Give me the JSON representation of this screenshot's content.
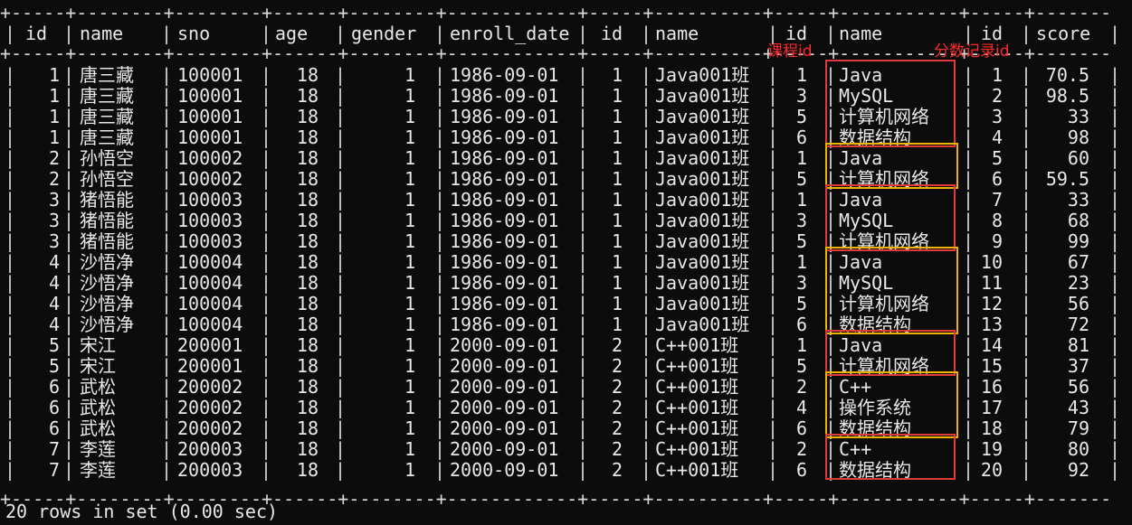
{
  "columns": [
    "id",
    "name",
    "sno",
    "age",
    "gender",
    "enroll_date",
    "id",
    "name",
    "id",
    "name",
    "id",
    "score"
  ],
  "annotations": {
    "course_id": "课程id",
    "score_record_id": "分数记录id"
  },
  "rows": [
    [
      "1",
      "唐三藏",
      "100001",
      "18",
      "1",
      "1986-09-01",
      "1",
      "Java001班",
      "1",
      "Java",
      "1",
      "70.5"
    ],
    [
      "1",
      "唐三藏",
      "100001",
      "18",
      "1",
      "1986-09-01",
      "1",
      "Java001班",
      "3",
      "MySQL",
      "2",
      "98.5"
    ],
    [
      "1",
      "唐三藏",
      "100001",
      "18",
      "1",
      "1986-09-01",
      "1",
      "Java001班",
      "5",
      "计算机网络",
      "3",
      "33"
    ],
    [
      "1",
      "唐三藏",
      "100001",
      "18",
      "1",
      "1986-09-01",
      "1",
      "Java001班",
      "6",
      "数据结构",
      "4",
      "98"
    ],
    [
      "2",
      "孙悟空",
      "100002",
      "18",
      "1",
      "1986-09-01",
      "1",
      "Java001班",
      "1",
      "Java",
      "5",
      "60"
    ],
    [
      "2",
      "孙悟空",
      "100002",
      "18",
      "1",
      "1986-09-01",
      "1",
      "Java001班",
      "5",
      "计算机网络",
      "6",
      "59.5"
    ],
    [
      "3",
      "猪悟能",
      "100003",
      "18",
      "1",
      "1986-09-01",
      "1",
      "Java001班",
      "1",
      "Java",
      "7",
      "33"
    ],
    [
      "3",
      "猪悟能",
      "100003",
      "18",
      "1",
      "1986-09-01",
      "1",
      "Java001班",
      "3",
      "MySQL",
      "8",
      "68"
    ],
    [
      "3",
      "猪悟能",
      "100003",
      "18",
      "1",
      "1986-09-01",
      "1",
      "Java001班",
      "5",
      "计算机网络",
      "9",
      "99"
    ],
    [
      "4",
      "沙悟净",
      "100004",
      "18",
      "1",
      "1986-09-01",
      "1",
      "Java001班",
      "1",
      "Java",
      "10",
      "67"
    ],
    [
      "4",
      "沙悟净",
      "100004",
      "18",
      "1",
      "1986-09-01",
      "1",
      "Java001班",
      "3",
      "MySQL",
      "11",
      "23"
    ],
    [
      "4",
      "沙悟净",
      "100004",
      "18",
      "1",
      "1986-09-01",
      "1",
      "Java001班",
      "5",
      "计算机网络",
      "12",
      "56"
    ],
    [
      "4",
      "沙悟净",
      "100004",
      "18",
      "1",
      "1986-09-01",
      "1",
      "Java001班",
      "6",
      "数据结构",
      "13",
      "72"
    ],
    [
      "5",
      "宋江",
      "200001",
      "18",
      "1",
      "2000-09-01",
      "2",
      "C++001班",
      "1",
      "Java",
      "14",
      "81"
    ],
    [
      "5",
      "宋江",
      "200001",
      "18",
      "1",
      "2000-09-01",
      "2",
      "C++001班",
      "5",
      "计算机网络",
      "15",
      "37"
    ],
    [
      "6",
      "武松",
      "200002",
      "18",
      "1",
      "2000-09-01",
      "2",
      "C++001班",
      "2",
      "C++",
      "16",
      "56"
    ],
    [
      "6",
      "武松",
      "200002",
      "18",
      "1",
      "2000-09-01",
      "2",
      "C++001班",
      "4",
      "操作系统",
      "17",
      "43"
    ],
    [
      "6",
      "武松",
      "200002",
      "18",
      "1",
      "2000-09-01",
      "2",
      "C++001班",
      "6",
      "数据结构",
      "18",
      "79"
    ],
    [
      "7",
      "李莲",
      "200003",
      "18",
      "1",
      "2000-09-01",
      "2",
      "C++001班",
      "2",
      "C++",
      "19",
      "80"
    ],
    [
      "7",
      "李莲",
      "200003",
      "18",
      "1",
      "2000-09-01",
      "2",
      "C++001班",
      "6",
      "数据结构",
      "20",
      "92"
    ]
  ],
  "groups": [
    {
      "rows": [
        0,
        3
      ],
      "color": "red"
    },
    {
      "rows": [
        4,
        5
      ],
      "color": "yellow"
    },
    {
      "rows": [
        6,
        8
      ],
      "color": "red"
    },
    {
      "rows": [
        9,
        12
      ],
      "color": "yellow"
    },
    {
      "rows": [
        13,
        14
      ],
      "color": "red"
    },
    {
      "rows": [
        15,
        17
      ],
      "color": "yellow"
    },
    {
      "rows": [
        18,
        19
      ],
      "color": "red"
    }
  ],
  "colors": {
    "red": "#e03b3b",
    "yellow": "#f0b400",
    "annotation": "#ff2a2a"
  },
  "footer": "20 rows in set (0.00 sec)"
}
